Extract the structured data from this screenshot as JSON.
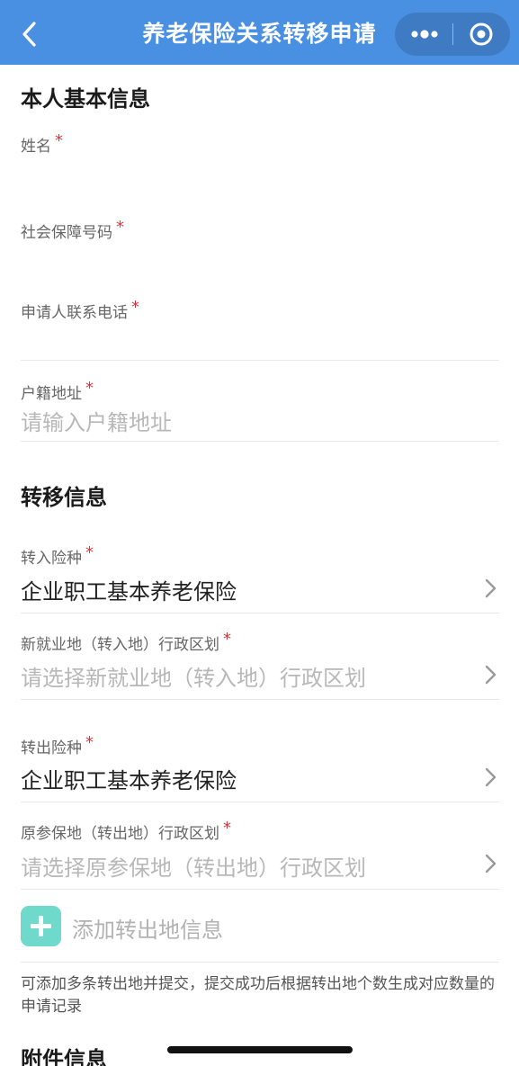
{
  "navbar": {
    "title": "养老保险关系转移申请",
    "back_icon": "chevron-left-icon",
    "more_icon": "more-dots-icon",
    "close_icon": "target-circle-icon",
    "bg_color": "#4a90e2"
  },
  "personal": {
    "section_title": "本人基本信息",
    "name_label": "姓名",
    "ssn_label": "社会保障号码",
    "phone_label": "申请人联系电话",
    "hukou_label": "户籍地址",
    "hukou_placeholder": "请输入户籍地址",
    "required_mark": "*"
  },
  "transfer": {
    "section_title": "转移信息",
    "in_type_label": "转入险种",
    "in_type_value": "企业职工基本养老保险",
    "new_region_label": "新就业地（转入地）行政区划",
    "new_region_placeholder": "请选择新就业地（转入地）行政区划",
    "out_type_label": "转出险种",
    "out_type_value": "企业职工基本养老保险",
    "orig_region_label": "原参保地（转出地）行政区划",
    "orig_region_placeholder": "请选择原参保地（转出地）行政区划",
    "add_label": "添加转出地信息",
    "add_icon": "plus-icon",
    "note": "可添加多条转出地并提交，提交成功后根据转出地个数生成对应数量的申请记录"
  },
  "attachments": {
    "section_title": "附件信息"
  },
  "colors": {
    "required": "#d9363e",
    "add_button": "#6fd9cb",
    "placeholder": "#b8b8b8"
  }
}
